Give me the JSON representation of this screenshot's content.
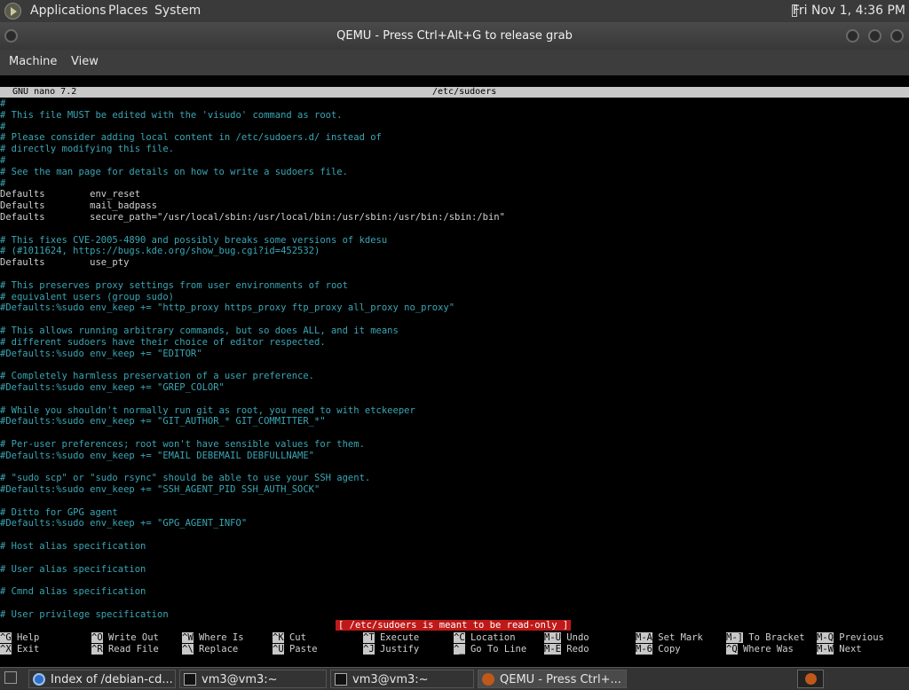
{
  "top_panel": {
    "menus": [
      "Applications",
      "Places",
      "System"
    ],
    "clock": "Fri Nov 1,  4:36 PM"
  },
  "window": {
    "title": "QEMU - Press Ctrl+Alt+G to release grab",
    "menus": [
      "Machine",
      "View"
    ]
  },
  "nano": {
    "version": "GNU nano 7.2",
    "filename": "/etc/sudoers",
    "lines": [
      {
        "t": "#",
        "c": "comment"
      },
      {
        "t": "# This file MUST be edited with the 'visudo' command as root.",
        "c": "comment"
      },
      {
        "t": "#",
        "c": "comment"
      },
      {
        "t": "# Please consider adding local content in /etc/sudoers.d/ instead of",
        "c": "comment"
      },
      {
        "t": "# directly modifying this file.",
        "c": "comment"
      },
      {
        "t": "#",
        "c": "comment"
      },
      {
        "t": "# See the man page for details on how to write a sudoers file.",
        "c": "comment"
      },
      {
        "t": "#",
        "c": "comment"
      },
      {
        "t": "Defaults        env_reset",
        "c": "default"
      },
      {
        "t": "Defaults        mail_badpass",
        "c": "default"
      },
      {
        "t": "Defaults        secure_path=\"/usr/local/sbin:/usr/local/bin:/usr/sbin:/usr/bin:/sbin:/bin\"",
        "c": "default"
      },
      {
        "t": "",
        "c": "default"
      },
      {
        "t": "# This fixes CVE-2005-4890 and possibly breaks some versions of kdesu",
        "c": "comment"
      },
      {
        "t": "# (#1011624, https://bugs.kde.org/show_bug.cgi?id=452532)",
        "c": "comment"
      },
      {
        "t": "Defaults        use_pty",
        "c": "default"
      },
      {
        "t": "",
        "c": "default"
      },
      {
        "t": "# This preserves proxy settings from user environments of root",
        "c": "comment"
      },
      {
        "t": "# equivalent users (group sudo)",
        "c": "comment"
      },
      {
        "t": "#Defaults:%sudo env_keep += \"http_proxy https_proxy ftp_proxy all_proxy no_proxy\"",
        "c": "comment"
      },
      {
        "t": "",
        "c": "default"
      },
      {
        "t": "# This allows running arbitrary commands, but so does ALL, and it means",
        "c": "comment"
      },
      {
        "t": "# different sudoers have their choice of editor respected.",
        "c": "comment"
      },
      {
        "t": "#Defaults:%sudo env_keep += \"EDITOR\"",
        "c": "comment"
      },
      {
        "t": "",
        "c": "default"
      },
      {
        "t": "# Completely harmless preservation of a user preference.",
        "c": "comment"
      },
      {
        "t": "#Defaults:%sudo env_keep += \"GREP_COLOR\"",
        "c": "comment"
      },
      {
        "t": "",
        "c": "default"
      },
      {
        "t": "# While you shouldn't normally run git as root, you need to with etckeeper",
        "c": "comment"
      },
      {
        "t": "#Defaults:%sudo env_keep += \"GIT_AUTHOR_* GIT_COMMITTER_*\"",
        "c": "comment"
      },
      {
        "t": "",
        "c": "default"
      },
      {
        "t": "# Per-user preferences; root won't have sensible values for them.",
        "c": "comment"
      },
      {
        "t": "#Defaults:%sudo env_keep += \"EMAIL DEBEMAIL DEBFULLNAME\"",
        "c": "comment"
      },
      {
        "t": "",
        "c": "default"
      },
      {
        "t": "# \"sudo scp\" or \"sudo rsync\" should be able to use your SSH agent.",
        "c": "comment"
      },
      {
        "t": "#Defaults:%sudo env_keep += \"SSH_AGENT_PID SSH_AUTH_SOCK\"",
        "c": "comment"
      },
      {
        "t": "",
        "c": "default"
      },
      {
        "t": "# Ditto for GPG agent",
        "c": "comment"
      },
      {
        "t": "#Defaults:%sudo env_keep += \"GPG_AGENT_INFO\"",
        "c": "comment"
      },
      {
        "t": "",
        "c": "default"
      },
      {
        "t": "# Host alias specification",
        "c": "comment"
      },
      {
        "t": "",
        "c": "default"
      },
      {
        "t": "# User alias specification",
        "c": "comment"
      },
      {
        "t": "",
        "c": "default"
      },
      {
        "t": "# Cmnd alias specification",
        "c": "comment"
      },
      {
        "t": "",
        "c": "default"
      },
      {
        "t": "# User privilege specification",
        "c": "comment"
      }
    ],
    "status_message": "[ /etc/sudoers is meant to be read-only ]",
    "shortcuts_row1": [
      {
        "key": "^G",
        "label": "Help"
      },
      {
        "key": "^O",
        "label": "Write Out"
      },
      {
        "key": "^W",
        "label": "Where Is"
      },
      {
        "key": "^K",
        "label": "Cut"
      },
      {
        "key": "^T",
        "label": "Execute"
      },
      {
        "key": "^C",
        "label": "Location"
      },
      {
        "key": "M-U",
        "label": "Undo"
      },
      {
        "key": "M-A",
        "label": "Set Mark"
      },
      {
        "key": "M-]",
        "label": "To Bracket"
      },
      {
        "key": "M-Q",
        "label": "Previous"
      }
    ],
    "shortcuts_row2": [
      {
        "key": "^X",
        "label": "Exit"
      },
      {
        "key": "^R",
        "label": "Read File"
      },
      {
        "key": "^\\",
        "label": "Replace"
      },
      {
        "key": "^U",
        "label": "Paste"
      },
      {
        "key": "^J",
        "label": "Justify"
      },
      {
        "key": "^_",
        "label": "Go To Line"
      },
      {
        "key": "M-E",
        "label": "Redo"
      },
      {
        "key": "M-6",
        "label": "Copy"
      },
      {
        "key": "^Q",
        "label": "Where Was"
      },
      {
        "key": "M-W",
        "label": "Next"
      }
    ]
  },
  "taskbar": {
    "tasks": [
      {
        "label": "Index of /debian-cd...",
        "icon": "chromium-icon",
        "active": false
      },
      {
        "label": "vm3@vm3:~",
        "icon": "terminal-icon",
        "active": false
      },
      {
        "label": "vm3@vm3:~",
        "icon": "terminal-icon",
        "active": false
      },
      {
        "label": "QEMU - Press Ctrl+...",
        "icon": "qemu-icon",
        "active": true
      }
    ]
  },
  "colors": {
    "comment": "#3aa6b5",
    "text": "#d0d0d0",
    "status_bg": "#c01818",
    "title_bar_bg": "#c8c8c8"
  }
}
